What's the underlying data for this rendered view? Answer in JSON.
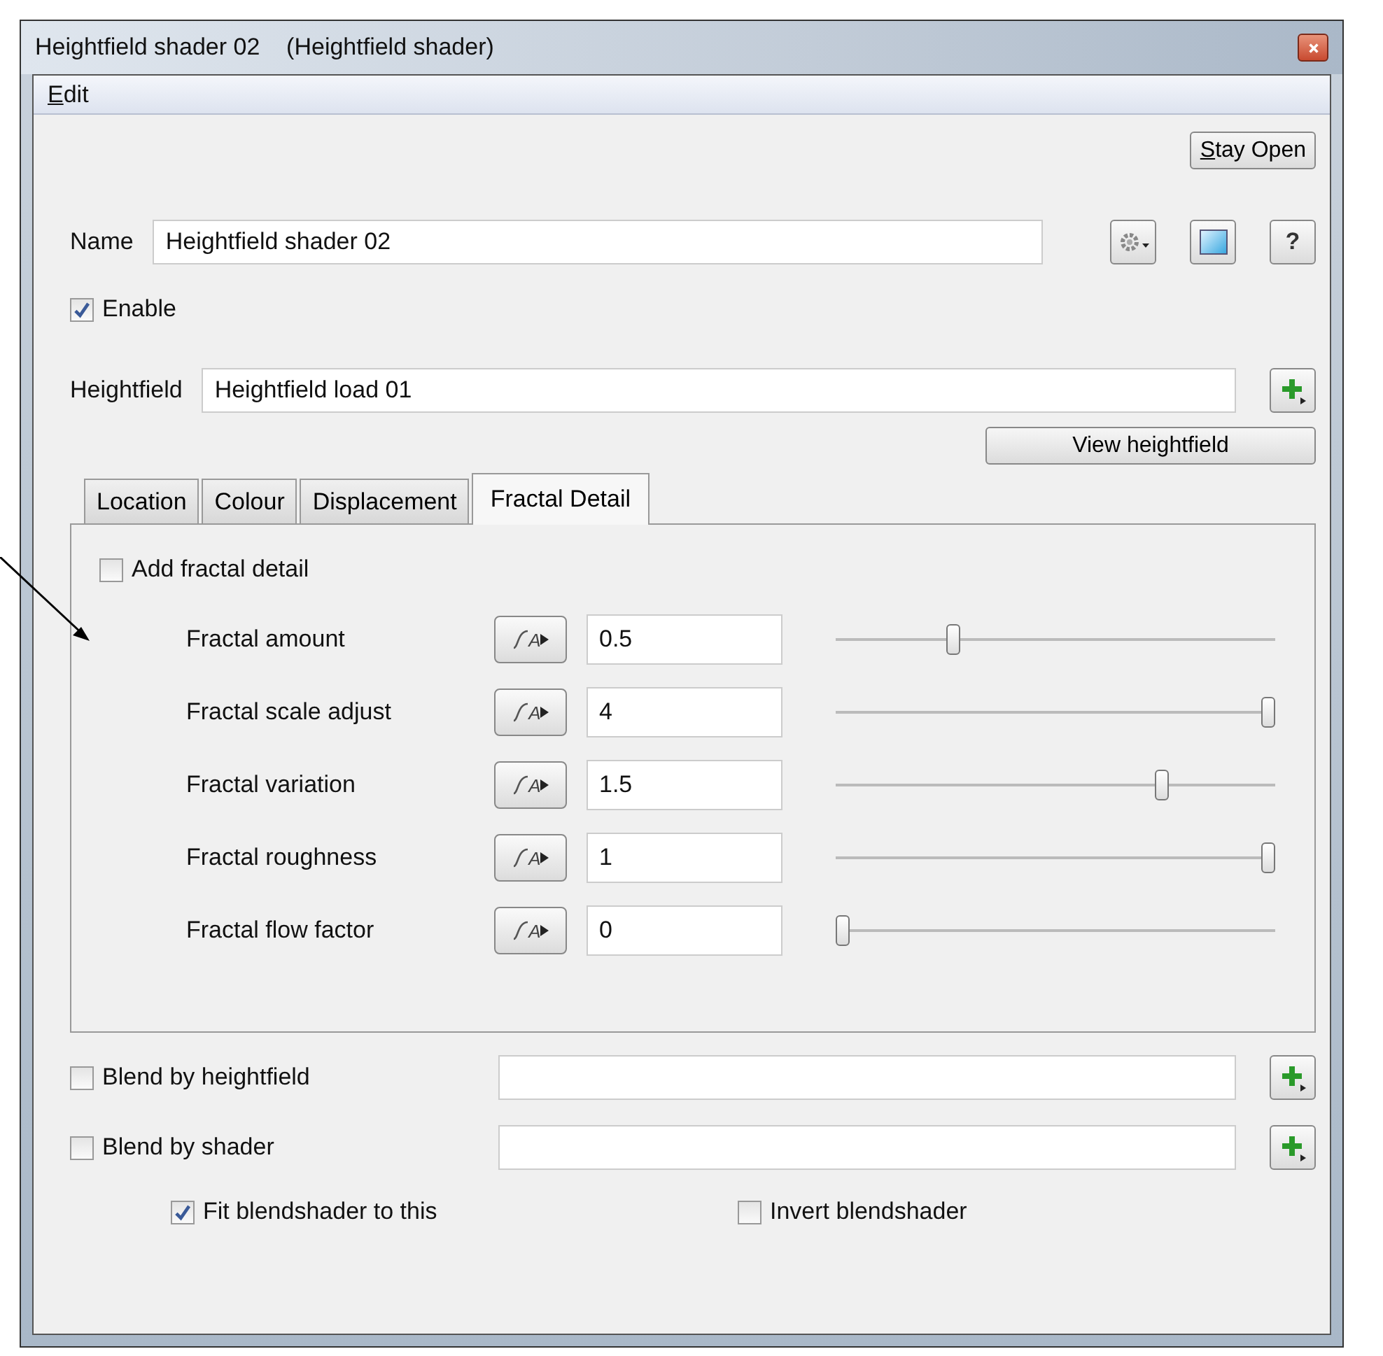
{
  "window": {
    "title": "Heightfield shader 02    (Heightfield shader)"
  },
  "menu": [
    {
      "label": "Edit"
    }
  ],
  "stay_open_button": "Stay Open",
  "name_row": {
    "label": "Name",
    "value": "Heightfield shader 02",
    "help_button": "?"
  },
  "enable": {
    "label": "Enable",
    "checked": true
  },
  "heightfield_row": {
    "label": "Heightfield",
    "value": "Heightfield load 01"
  },
  "view_button": "View heightfield",
  "tabs": [
    {
      "label": "Location",
      "selected": false
    },
    {
      "label": "Colour",
      "selected": false
    },
    {
      "label": "Displacement",
      "selected": false
    },
    {
      "label": "Fractal Detail",
      "selected": true
    }
  ],
  "add_fractal": {
    "label": "Add fractal detail",
    "checked": false
  },
  "parameters": [
    {
      "label": "Fractal amount",
      "anim_label": "A",
      "value": "0.5",
      "level": 0.26
    },
    {
      "label": "Fractal scale adjust",
      "anim_label": "A",
      "value": "4",
      "level": 1
    },
    {
      "label": "Fractal variation",
      "anim_label": "A",
      "value": "1.5",
      "level": 0.75
    },
    {
      "label": "Fractal roughness",
      "anim_label": "A",
      "value": "1",
      "level": 1
    },
    {
      "label": "Fractal flow factor",
      "anim_label": "A",
      "value": "0",
      "level": 0
    }
  ],
  "blends": [
    {
      "label": "Blend by heightfield",
      "checked": false
    },
    {
      "label": "Blend by shader",
      "checked": false
    }
  ],
  "options": [
    {
      "label": "Fit blendshader to this",
      "checked": true
    },
    {
      "label": "Invert blendshader",
      "checked": false
    }
  ]
}
